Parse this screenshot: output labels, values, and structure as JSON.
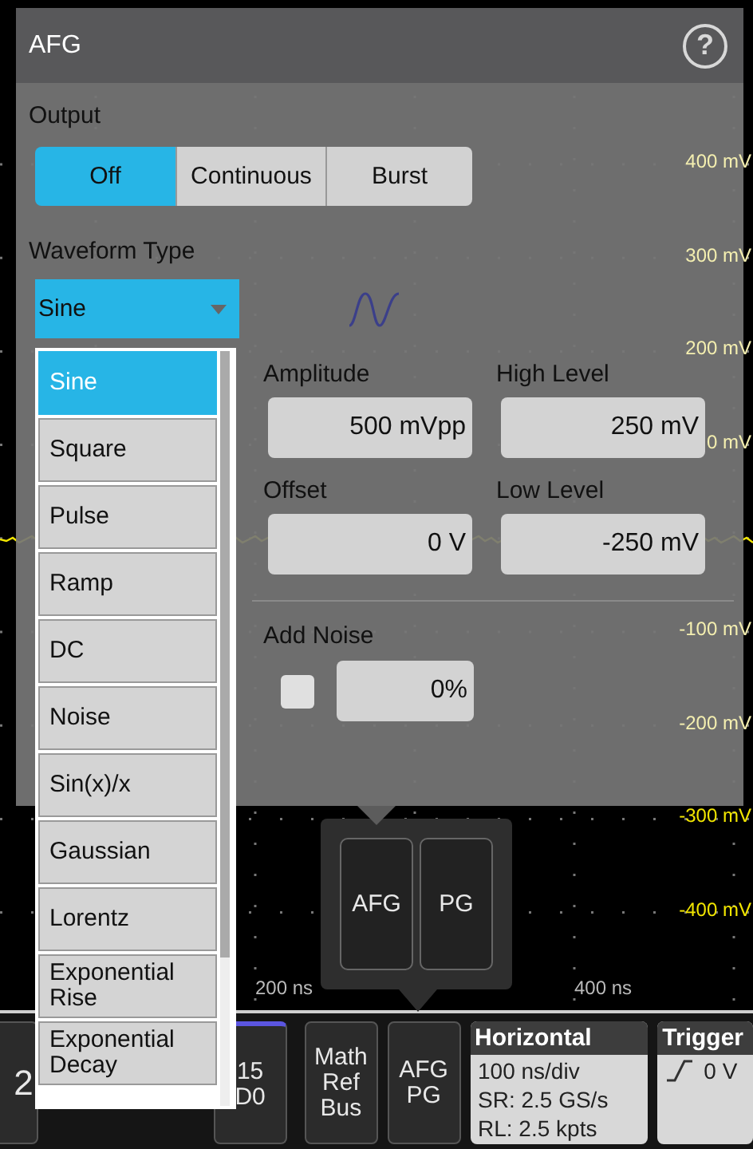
{
  "scope": {
    "voltage_labels": [
      "400 mV",
      "300 mV",
      "200 mV",
      "0 mV",
      "-100 mV",
      "-200 mV",
      "-300 mV",
      "-400 mV"
    ],
    "time_labels": [
      "200 ns",
      "400 ns"
    ]
  },
  "dialog": {
    "title": "AFG",
    "help": "?",
    "output": {
      "label": "Output",
      "options": [
        {
          "label": "Off",
          "selected": true
        },
        {
          "label": "Continuous",
          "selected": false
        },
        {
          "label": "Burst",
          "selected": false
        }
      ]
    },
    "waveform_type": {
      "label": "Waveform Type",
      "value": "Sine",
      "expanded": true,
      "options": [
        {
          "label": "Sine",
          "selected": true
        },
        {
          "label": "Square",
          "selected": false
        },
        {
          "label": "Pulse",
          "selected": false
        },
        {
          "label": "Ramp",
          "selected": false
        },
        {
          "label": "DC",
          "selected": false
        },
        {
          "label": "Noise",
          "selected": false
        },
        {
          "label": "Sin(x)/x",
          "selected": false
        },
        {
          "label": "Gaussian",
          "selected": false
        },
        {
          "label": "Lorentz",
          "selected": false
        },
        {
          "label": "Exponential Rise",
          "selected": false
        },
        {
          "label": "Exponential Decay",
          "selected": false
        }
      ]
    },
    "parameters": [
      {
        "label": "Amplitude",
        "value": "500 mVpp"
      },
      {
        "label": "High Level",
        "value": "250 mV"
      },
      {
        "label": "Offset",
        "value": "0 V"
      },
      {
        "label": "Low Level",
        "value": "-250 mV"
      }
    ],
    "add_noise": {
      "label": "Add Noise",
      "checked": false,
      "value": "0%"
    }
  },
  "popup": {
    "buttons": [
      "AFG",
      "PG"
    ]
  },
  "bottom_bar": {
    "buttons": [
      "2",
      "15 D0",
      "Math Ref Bus",
      "AFG PG"
    ],
    "horizontal": {
      "title": "Horizontal",
      "lines": [
        "100 ns/div",
        "SR: 2.5 GS/s",
        "RL: 2.5 kpts"
      ]
    },
    "trigger": {
      "title": "Trigger",
      "level": "0 V"
    }
  }
}
